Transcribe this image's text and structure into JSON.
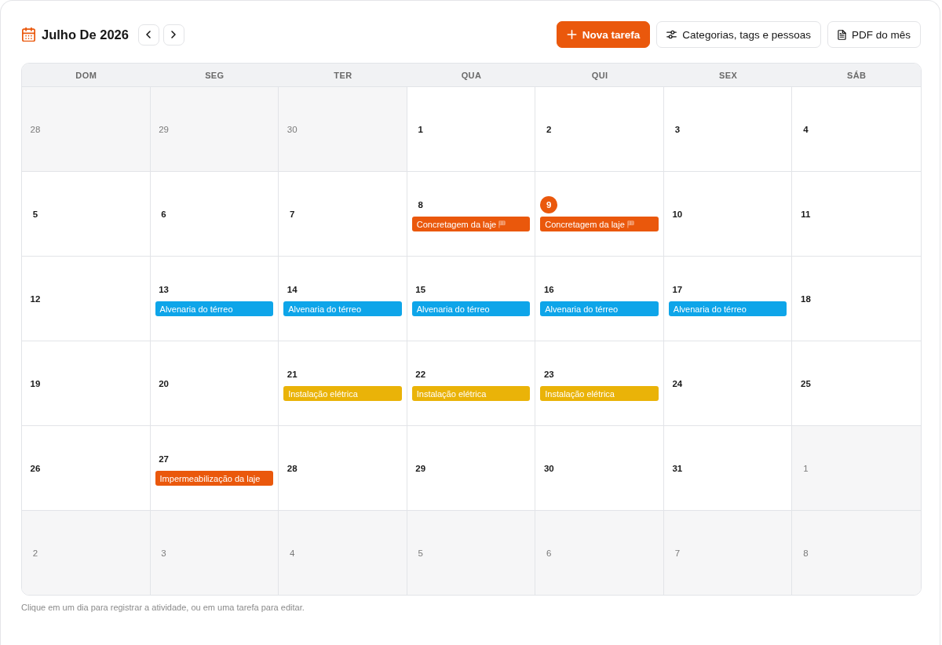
{
  "header": {
    "title": "Julho De 2026"
  },
  "actions": [
    {
      "label": "Nova tarefa",
      "kind": "add",
      "primary": true
    },
    {
      "label": "Categorias, tags e pessoas",
      "kind": "settings",
      "primary": false
    },
    {
      "label": "PDF do mês",
      "kind": "document",
      "primary": false
    }
  ],
  "calendar": {
    "weekdays": [
      "DOM",
      "SEG",
      "TER",
      "QUA",
      "QUI",
      "SEX",
      "SÁB"
    ],
    "weeks": [
      [
        {
          "day": "28",
          "in_month": false,
          "today": false
        },
        {
          "day": "29",
          "in_month": false,
          "today": false
        },
        {
          "day": "30",
          "in_month": false,
          "today": false
        },
        {
          "day": "1",
          "in_month": true,
          "today": false
        },
        {
          "day": "2",
          "in_month": true,
          "today": false
        },
        {
          "day": "3",
          "in_month": true,
          "today": false
        },
        {
          "day": "4",
          "in_month": true,
          "today": false
        }
      ],
      [
        {
          "day": "5",
          "in_month": true,
          "today": false
        },
        {
          "day": "6",
          "in_month": true,
          "today": false
        },
        {
          "day": "7",
          "in_month": true,
          "today": false
        },
        {
          "day": "8",
          "in_month": true,
          "today": false,
          "tasks": [
            {
              "title": "Concretagem da laje",
              "color": "#ea580c",
              "milestone": true
            }
          ]
        },
        {
          "day": "9",
          "in_month": true,
          "today": true,
          "tasks": [
            {
              "title": "Concretagem da laje",
              "color": "#ea580c",
              "milestone": true
            }
          ]
        },
        {
          "day": "10",
          "in_month": true,
          "today": false
        },
        {
          "day": "11",
          "in_month": true,
          "today": false
        }
      ],
      [
        {
          "day": "12",
          "in_month": true,
          "today": false
        },
        {
          "day": "13",
          "in_month": true,
          "today": false,
          "tasks": [
            {
              "title": "Alvenaria do térreo",
              "color": "#0ea5e9",
              "milestone": false
            }
          ]
        },
        {
          "day": "14",
          "in_month": true,
          "today": false,
          "tasks": [
            {
              "title": "Alvenaria do térreo",
              "color": "#0ea5e9",
              "milestone": false
            }
          ]
        },
        {
          "day": "15",
          "in_month": true,
          "today": false,
          "tasks": [
            {
              "title": "Alvenaria do térreo",
              "color": "#0ea5e9",
              "milestone": false
            }
          ]
        },
        {
          "day": "16",
          "in_month": true,
          "today": false,
          "tasks": [
            {
              "title": "Alvenaria do térreo",
              "color": "#0ea5e9",
              "milestone": false
            }
          ]
        },
        {
          "day": "17",
          "in_month": true,
          "today": false,
          "tasks": [
            {
              "title": "Alvenaria do térreo",
              "color": "#0ea5e9",
              "milestone": false
            }
          ]
        },
        {
          "day": "18",
          "in_month": true,
          "today": false
        }
      ],
      [
        {
          "day": "19",
          "in_month": true,
          "today": false
        },
        {
          "day": "20",
          "in_month": true,
          "today": false
        },
        {
          "day": "21",
          "in_month": true,
          "today": false,
          "tasks": [
            {
              "title": "Instalação elétrica",
              "color": "#eab308",
              "milestone": false
            }
          ]
        },
        {
          "day": "22",
          "in_month": true,
          "today": false,
          "tasks": [
            {
              "title": "Instalação elétrica",
              "color": "#eab308",
              "milestone": false
            }
          ]
        },
        {
          "day": "23",
          "in_month": true,
          "today": false,
          "tasks": [
            {
              "title": "Instalação elétrica",
              "color": "#eab308",
              "milestone": false
            }
          ]
        },
        {
          "day": "24",
          "in_month": true,
          "today": false
        },
        {
          "day": "25",
          "in_month": true,
          "today": false
        }
      ],
      [
        {
          "day": "26",
          "in_month": true,
          "today": false
        },
        {
          "day": "27",
          "in_month": true,
          "today": false,
          "tasks": [
            {
              "title": "Impermeabilização da laje",
              "color": "#ea580c",
              "milestone": false
            }
          ]
        },
        {
          "day": "28",
          "in_month": true,
          "today": false
        },
        {
          "day": "29",
          "in_month": true,
          "today": false
        },
        {
          "day": "30",
          "in_month": true,
          "today": false
        },
        {
          "day": "31",
          "in_month": true,
          "today": false
        },
        {
          "day": "1",
          "in_month": false,
          "today": false
        }
      ],
      [
        {
          "day": "2",
          "in_month": false,
          "today": false
        },
        {
          "day": "3",
          "in_month": false,
          "today": false
        },
        {
          "day": "4",
          "in_month": false,
          "today": false
        },
        {
          "day": "5",
          "in_month": false,
          "today": false
        },
        {
          "day": "6",
          "in_month": false,
          "today": false
        },
        {
          "day": "7",
          "in_month": false,
          "today": false
        },
        {
          "day": "8",
          "in_month": false,
          "today": false
        }
      ]
    ]
  },
  "hint": "Clique em um dia para registrar a atividade, ou em uma tarefa para editar."
}
